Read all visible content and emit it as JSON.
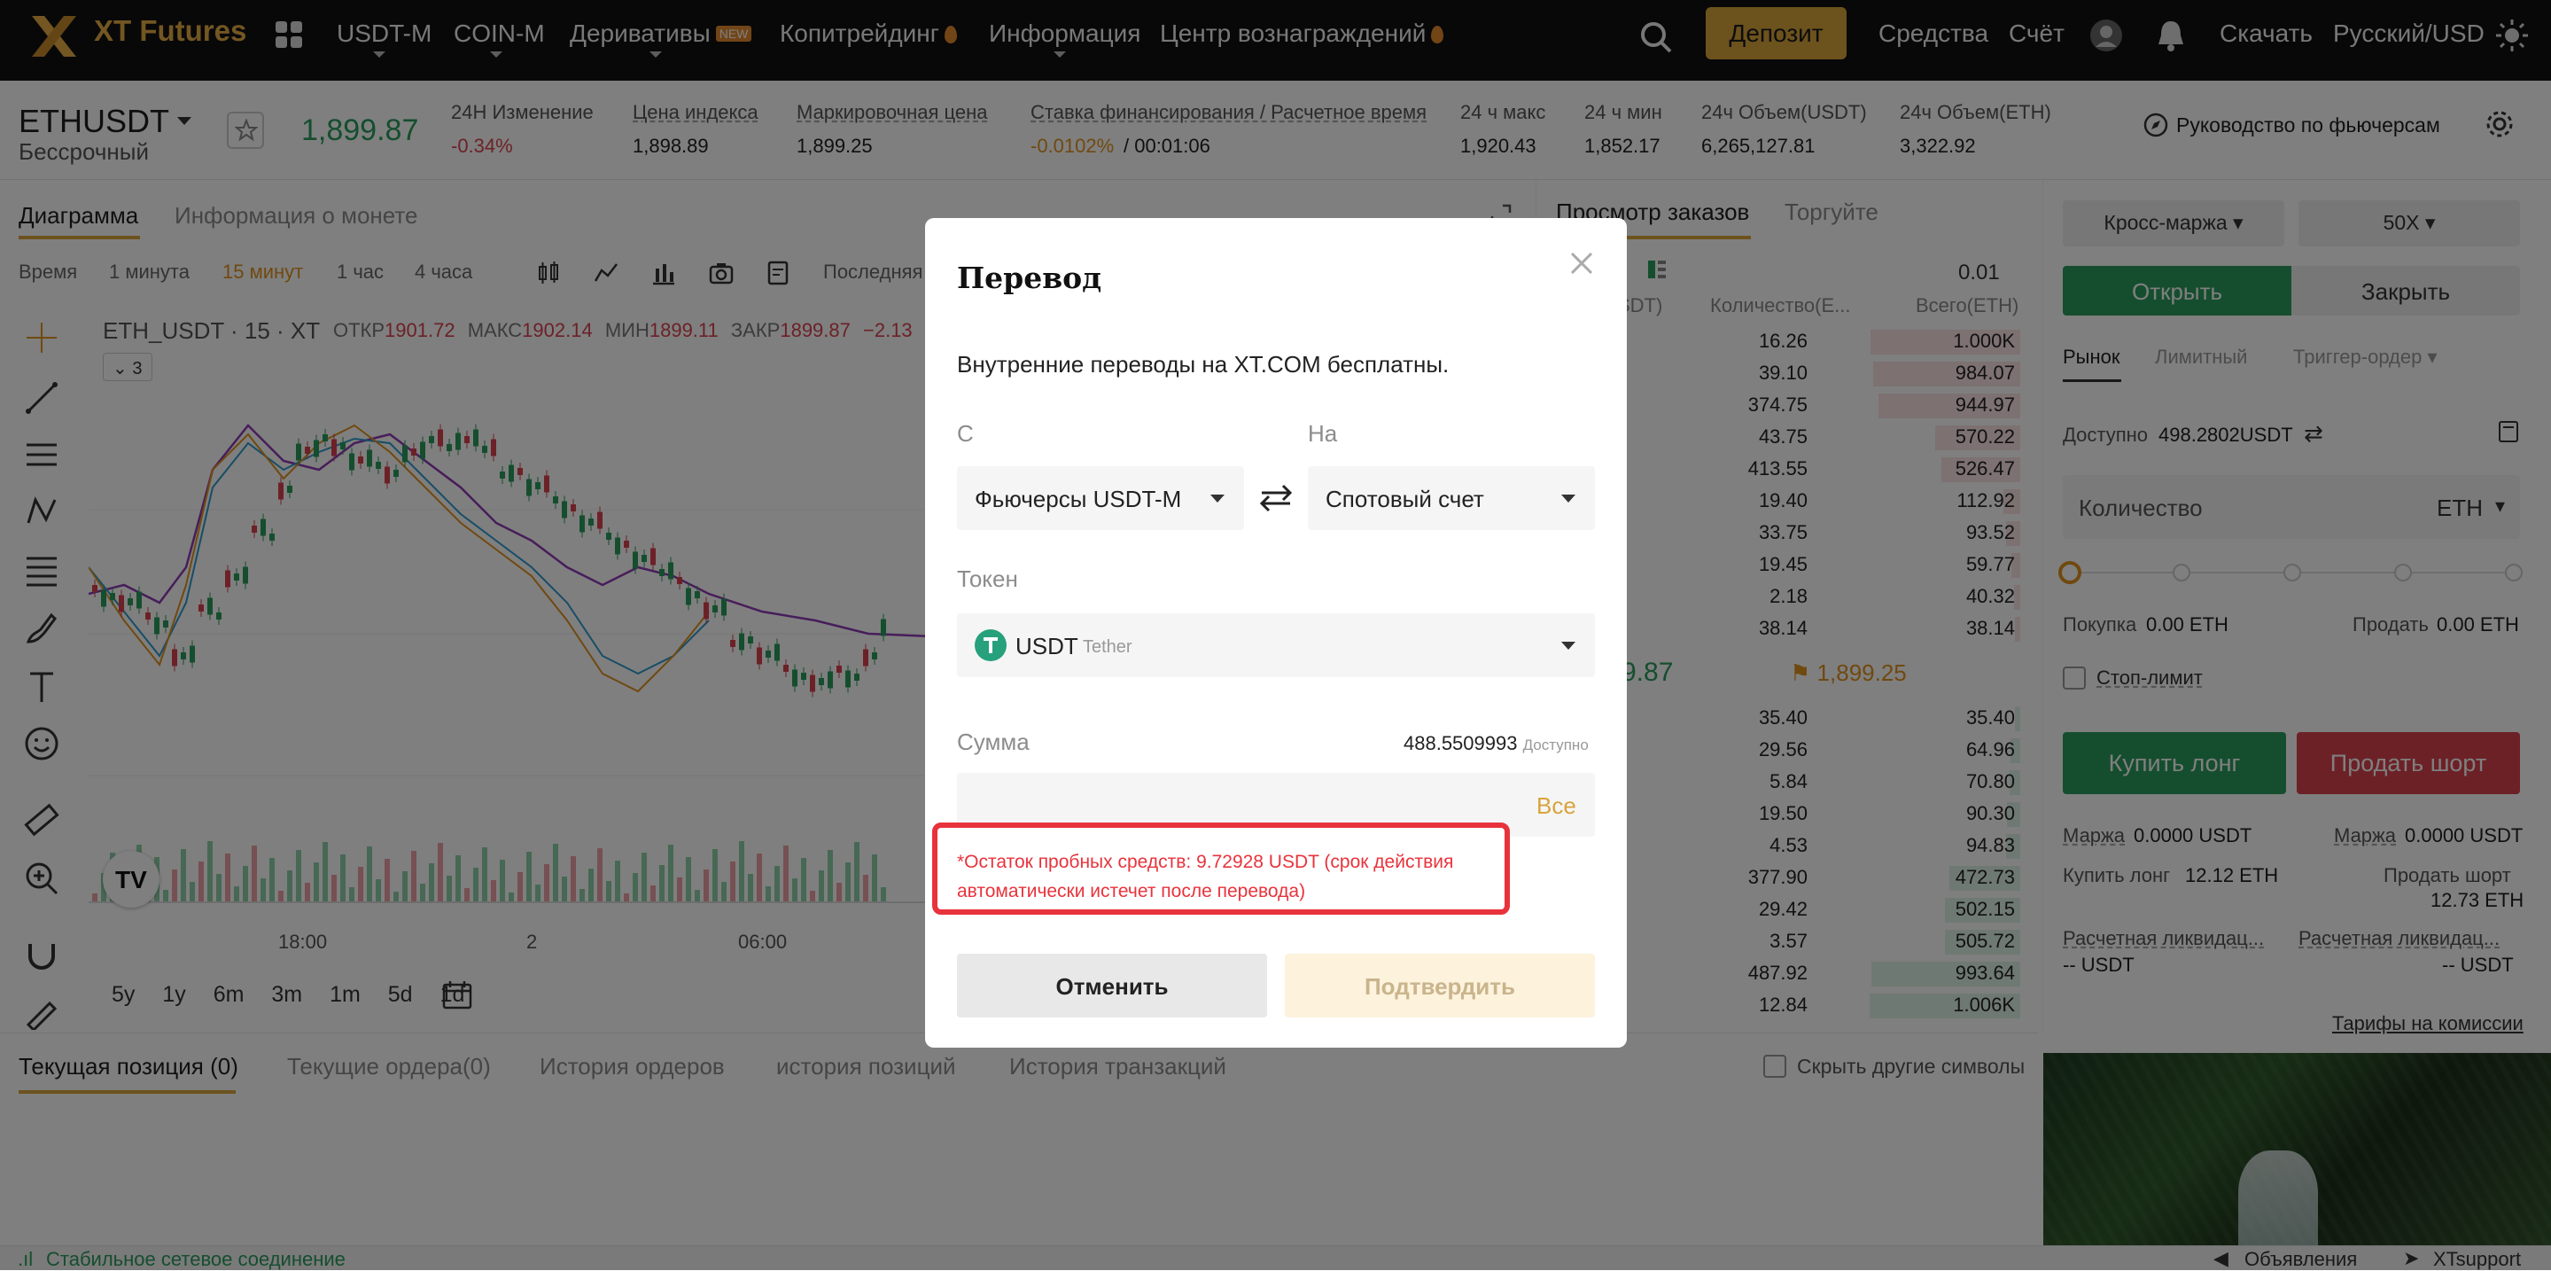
{
  "nav": {
    "brand": "XT Futures",
    "items": [
      "USDT-M",
      "COIN-M",
      "Деривативы",
      "Копитрейдинг",
      "Информация",
      "Центр вознаграждений"
    ],
    "new_badge": "NEW",
    "deposit": "Депозит",
    "assets": "Средства",
    "account": "Счёт",
    "download": "Скачать",
    "lang": "Русский/USD"
  },
  "ticker": {
    "symbol": "ETHUSDT",
    "contract": "Бессрочный",
    "last_price": "1,899.87",
    "change_label": "24H Изменение",
    "change_value": "-0.34%",
    "index_label": "Цена индекса",
    "index_value": "1,898.89",
    "mark_label": "Маркировочная цена",
    "mark_value": "1,899.25",
    "funding_label": "Ставка финансирования / Расчетное время",
    "funding_rate": "-0.0102%",
    "funding_time": "/ 00:01:06",
    "high_label": "24 ч макс",
    "high_value": "1,920.43",
    "low_label": "24 ч мин",
    "low_value": "1,852.17",
    "vol_usdt_label": "24ч Объем(USDT)",
    "vol_usdt_value": "6,265,127.81",
    "vol_eth_label": "24ч Объем(ETH)",
    "vol_eth_value": "3,322.92",
    "guide": "Руководство по фьючерсам"
  },
  "chart": {
    "tab_chart": "Диаграмма",
    "tab_info": "Информация о монете",
    "timeframes": [
      "Время",
      "1 минута",
      "15 минут",
      "1 час",
      "4 часа"
    ],
    "last_label": "Последняя",
    "legend_symbol": "ETH_USDT · 15 · XT",
    "open_lbl": "ОТКР",
    "open_val": "1901.72",
    "high_lbl": "МАКС",
    "high_val": "1902.14",
    "low_lbl": "МИН",
    "low_val": "1899.11",
    "close_lbl": "ЗАКР",
    "close_val": "1899.87",
    "chg_val": "−2.13",
    "indicator_count": "3",
    "time_labels": [
      "18:00",
      "2",
      "06:00"
    ],
    "ranges": [
      "5y",
      "1y",
      "6m",
      "3m",
      "1m",
      "5d",
      "1d"
    ]
  },
  "orderbook": {
    "tab_book": "Просмотр заказов",
    "tab_trades": "Торгуйте",
    "precision": "0.01",
    "col_price": "SDT)",
    "col_qty": "Количество(E...",
    "col_total": "Всего(ETH)",
    "asks": [
      {
        "q": "16.26",
        "t": "1.000K"
      },
      {
        "q": "39.10",
        "t": "984.07"
      },
      {
        "q": "374.75",
        "t": "944.97"
      },
      {
        "q": "43.75",
        "t": "570.22"
      },
      {
        "q": "413.55",
        "t": "526.47"
      },
      {
        "q": "19.40",
        "t": "112.92"
      },
      {
        "q": "33.75",
        "t": "93.52"
      },
      {
        "q": "19.45",
        "t": "59.77"
      },
      {
        "q": "2.18",
        "t": "40.32"
      },
      {
        "q": "38.14",
        "t": "38.14"
      }
    ],
    "mid_price": "9.87",
    "mark_price": "1,899.25",
    "bids": [
      {
        "q": "35.40",
        "t": "35.40"
      },
      {
        "q": "29.56",
        "t": "64.96"
      },
      {
        "q": "5.84",
        "t": "70.80"
      },
      {
        "q": "19.50",
        "t": "90.30"
      },
      {
        "q": "4.53",
        "t": "94.83"
      },
      {
        "q": "377.90",
        "t": "472.73"
      },
      {
        "q": "29.42",
        "t": "502.15"
      },
      {
        "q": "3.57",
        "t": "505.72"
      },
      {
        "q": "487.92",
        "t": "993.64"
      },
      {
        "q": "12.84",
        "t": "1.006K"
      }
    ]
  },
  "trade": {
    "margin_mode": "Кросс-маржа",
    "leverage": "50X",
    "open": "Открыть",
    "close": "Закрыть",
    "type_market": "Рынок",
    "type_limit": "Лимитный",
    "type_trigger": "Триггер-ордер",
    "available_label": "Доступно",
    "available_value": "498.2802USDT",
    "qty_placeholder": "Количество",
    "qty_unit": "ETH",
    "buy_label": "Покупка",
    "buy_value": "0.00 ETH",
    "sell_label": "Продать",
    "sell_value": "0.00 ETH",
    "stop_limit": "Стоп-лимит",
    "buy_long": "Купить лонг",
    "sell_short": "Продать шорт",
    "margin_label": "Маржа",
    "margin_long": "0.0000 USDT",
    "margin_short": "0.0000 USDT",
    "can_long_label": "Купить лонг",
    "can_long_value": "12.12 ETH",
    "can_short_label": "Продать шорт",
    "can_short_value": "12.73 ETH",
    "liq_label": "Расчетная ликвидац...",
    "liq_long": "-- USDT",
    "liq_short": "-- USDT",
    "fees": "Тарифы на комиссии"
  },
  "bottom": {
    "tabs": [
      "Текущая позиция (0)",
      "Текущие ордера(0)",
      "История ордеров",
      "история позиций",
      "История транзакций"
    ],
    "hide_symbols": "Скрыть другие символы"
  },
  "status": {
    "connection": "Стабильное сетевое соединение",
    "announcements": "Объявления",
    "support": "XTsupport"
  },
  "modal": {
    "title": "Перевод",
    "subtitle": "Внутренние переводы на XT.COM бесплатны.",
    "from_label": "С",
    "to_label": "На",
    "from_value": "Фьючерсы USDT-M",
    "to_value": "Спотовый счет",
    "token_label": "Токен",
    "token_symbol": "USDT",
    "token_name": "Tether",
    "amount_label": "Сумма",
    "available_amount": "488.5509993",
    "available_label": "Доступно",
    "all": "Все",
    "warning": "*Остаток пробных средств: 9.72928 USDT (срок действия автоматически истечет после перевода)",
    "cancel": "Отменить",
    "confirm": "Подтвердить"
  },
  "colors": {
    "accent": "#d9a43b",
    "green": "#2a9d5c",
    "red": "#d9434e",
    "warning_border": "#e8333c"
  }
}
